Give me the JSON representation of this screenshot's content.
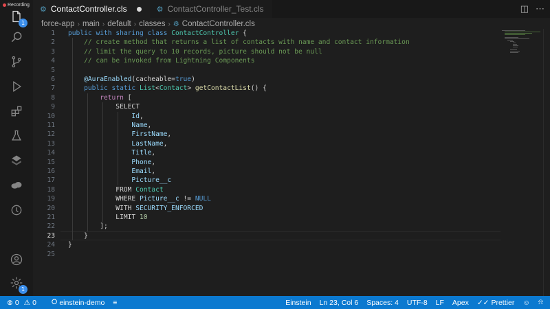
{
  "recording": {
    "label": "Recording"
  },
  "tabs": [
    {
      "label": "ContactController.cls",
      "icon": "file-code-icon",
      "modified": true,
      "active": true
    },
    {
      "label": "ContactController_Test.cls",
      "icon": "file-code-icon",
      "modified": false,
      "active": false
    }
  ],
  "breadcrumb": [
    "force-app",
    "main",
    "default",
    "classes",
    "ContactController.cls"
  ],
  "activity": {
    "explorer_badge": "1",
    "settings_badge": "1"
  },
  "editor": {
    "current_line": 23,
    "lines": [
      {
        "n": "1",
        "html_key": "l1"
      },
      {
        "n": "2"
      },
      {
        "n": "3"
      },
      {
        "n": "4"
      },
      {
        "n": "5"
      },
      {
        "n": "6"
      },
      {
        "n": "7"
      },
      {
        "n": "8"
      },
      {
        "n": "9"
      },
      {
        "n": "10"
      },
      {
        "n": "11"
      },
      {
        "n": "12"
      },
      {
        "n": "13"
      },
      {
        "n": "14"
      },
      {
        "n": "15"
      },
      {
        "n": "16"
      },
      {
        "n": "17"
      },
      {
        "n": "18"
      },
      {
        "n": "19"
      },
      {
        "n": "20"
      },
      {
        "n": "21"
      },
      {
        "n": "22"
      },
      {
        "n": "23"
      },
      {
        "n": "24"
      },
      {
        "n": "25"
      }
    ],
    "code": [
      [
        [
          "kw2",
          "public"
        ],
        [
          "t",
          " "
        ],
        [
          "kw2",
          "with sharing class"
        ],
        [
          "t",
          " "
        ],
        [
          "cls",
          "ContactController"
        ],
        [
          "t",
          " {"
        ]
      ],
      [
        [
          "t",
          "    "
        ],
        [
          "cm",
          "// create method that returns a list of contacts with name and contact information"
        ]
      ],
      [
        [
          "t",
          "    "
        ],
        [
          "cm",
          "// limit the query to 10 records, picture should not be null"
        ]
      ],
      [
        [
          "t",
          "    "
        ],
        [
          "cm",
          "// can be invoked from Lightning Components"
        ]
      ],
      [],
      [
        [
          "t",
          "    "
        ],
        [
          "ann",
          "@AuraEnabled"
        ],
        [
          "t",
          "(cacheable="
        ],
        [
          "kw2",
          "true"
        ],
        [
          "t",
          ")"
        ]
      ],
      [
        [
          "t",
          "    "
        ],
        [
          "kw2",
          "public static"
        ],
        [
          "t",
          " "
        ],
        [
          "cls",
          "List"
        ],
        [
          "t",
          "<"
        ],
        [
          "cls",
          "Contact"
        ],
        [
          "t",
          "> "
        ],
        [
          "fn",
          "getContactList"
        ],
        [
          "t",
          "() {"
        ]
      ],
      [
        [
          "t",
          "        "
        ],
        [
          "kw",
          "return"
        ],
        [
          "t",
          " ["
        ]
      ],
      [
        [
          "t",
          "            SELECT"
        ]
      ],
      [
        [
          "t",
          "                "
        ],
        [
          "fld",
          "Id"
        ],
        [
          "t",
          ","
        ]
      ],
      [
        [
          "t",
          "                "
        ],
        [
          "fld",
          "Name"
        ],
        [
          "t",
          ","
        ]
      ],
      [
        [
          "t",
          "                "
        ],
        [
          "fld",
          "FirstName"
        ],
        [
          "t",
          ","
        ]
      ],
      [
        [
          "t",
          "                "
        ],
        [
          "fld",
          "LastName"
        ],
        [
          "t",
          ","
        ]
      ],
      [
        [
          "t",
          "                "
        ],
        [
          "fld",
          "Title"
        ],
        [
          "t",
          ","
        ]
      ],
      [
        [
          "t",
          "                "
        ],
        [
          "fld",
          "Phone"
        ],
        [
          "t",
          ","
        ]
      ],
      [
        [
          "t",
          "                "
        ],
        [
          "fld",
          "Email"
        ],
        [
          "t",
          ","
        ]
      ],
      [
        [
          "t",
          "                "
        ],
        [
          "fld",
          "Picture__c"
        ]
      ],
      [
        [
          "t",
          "            FROM "
        ],
        [
          "cls",
          "Contact"
        ]
      ],
      [
        [
          "t",
          "            WHERE "
        ],
        [
          "fld",
          "Picture__c"
        ],
        [
          "t",
          " != "
        ],
        [
          "kw2",
          "NULL"
        ]
      ],
      [
        [
          "t",
          "            WITH "
        ],
        [
          "fld",
          "SECURITY_ENFORCED"
        ]
      ],
      [
        [
          "t",
          "            LIMIT "
        ],
        [
          "num",
          "10"
        ]
      ],
      [
        [
          "t",
          "        ];"
        ]
      ],
      [
        [
          "t",
          "    }"
        ]
      ],
      [
        [
          "t",
          "}"
        ]
      ],
      []
    ]
  },
  "status": {
    "errors": "0",
    "warnings": "0",
    "org": "einstein-demo",
    "einstein": "Einstein",
    "position": "Ln 23, Col 6",
    "spaces": "Spaces: 4",
    "encoding": "UTF-8",
    "eol": "LF",
    "language": "Apex",
    "prettier": "Prettier"
  },
  "colors": {
    "statusbar": "#0b79d0",
    "editor_bg": "#1e1e1e",
    "comment": "#6a9955",
    "keyword": "#569cd6",
    "type": "#4ec9b0"
  }
}
